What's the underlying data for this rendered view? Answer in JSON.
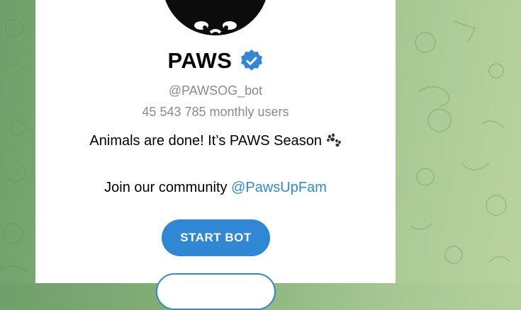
{
  "profile": {
    "name": "PAWS",
    "username": "@PAWSOG_bot",
    "monthly_users": "45 543 785 monthly users",
    "description": "Animals are done! It’s PAWS Season",
    "join_text": "Join our community ",
    "join_link": "@PawsUpFam"
  },
  "actions": {
    "start_label": "START BOT",
    "secondary_label": ""
  },
  "icons": {
    "verified": "verified-badge-icon",
    "paw": "paw-prints-icon"
  },
  "colors": {
    "accent": "#3088d4",
    "link": "#2a8bd6",
    "muted_text": "#8a8a8a",
    "background_green": "#8fb882"
  }
}
